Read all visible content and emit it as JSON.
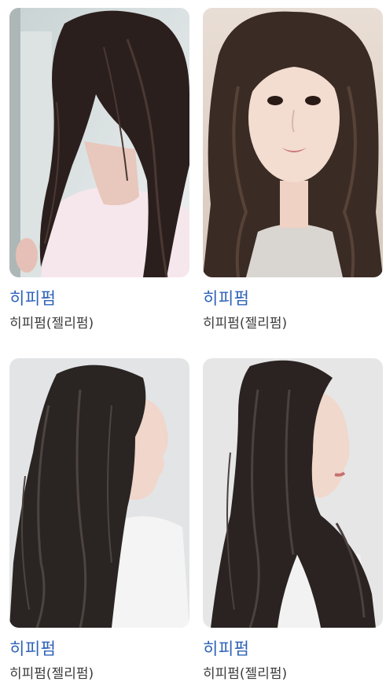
{
  "results": [
    {
      "title": "히피펌",
      "subtitle": "히피펌(젤리펌)",
      "image": "hippie-perm-photo-woman-side-profile-white-shirt"
    },
    {
      "title": "히피펌",
      "subtitle": "히피펌(젤리펌)",
      "image": "hippie-perm-photo-woman-front-selfie"
    },
    {
      "title": "히피펌",
      "subtitle": "히피펌(젤리펌)",
      "image": "hippie-perm-photo-woman-side-profile-white-background"
    },
    {
      "title": "히피펌",
      "subtitle": "히피펌(젤리펌)",
      "image": "hippie-perm-photo-woman-three-quarter-profile"
    }
  ]
}
